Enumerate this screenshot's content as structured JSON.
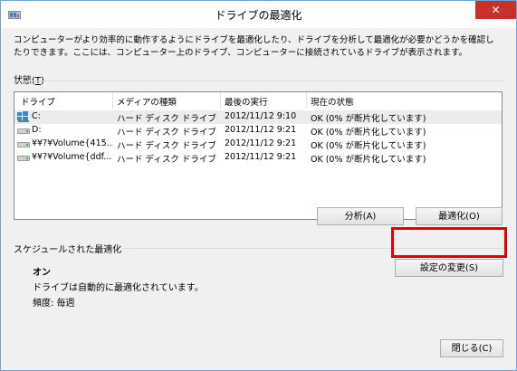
{
  "window": {
    "title": "ドライブの最適化",
    "close_label": "✕"
  },
  "description": "コンピューターがより効率的に動作するようにドライブを最適化したり、ドライブを分析して最適化が必要かどうかを確認したりできます。ここには、コンピューター上のドライブ、コンピューターに接続されているドライブが表示されます。",
  "status": {
    "label": "状態(",
    "accel": "T",
    "label_end": ")"
  },
  "table": {
    "columns": [
      "ドライブ",
      "メディアの種類",
      "最後の実行",
      "現在の状態"
    ],
    "rows": [
      {
        "drive": "C:",
        "media": "ハード ディスク ドライブ",
        "last_run": "2012/11/12 9:10",
        "status": "OK (0% が断片化しています)",
        "icon": "windows-drive-icon"
      },
      {
        "drive": "D:",
        "media": "ハード ディスク ドライブ",
        "last_run": "2012/11/12 9:21",
        "status": "OK (0% が断片化しています)",
        "icon": "hard-drive-icon"
      },
      {
        "drive": "¥¥?¥Volume{415...",
        "media": "ハード ディスク ドライブ",
        "last_run": "2012/11/12 9:21",
        "status": "OK (0% が断片化しています)",
        "icon": "hard-drive-icon"
      },
      {
        "drive": "¥¥?¥Volume{ddf...",
        "media": "ハード ディスク ドライブ",
        "last_run": "2012/11/12 9:21",
        "status": "OK (0% が断片化しています)",
        "icon": "hard-drive-icon"
      }
    ]
  },
  "buttons": {
    "analyze": "分析(A)",
    "optimize": "最適化(O)",
    "change_settings": "設定の変更(S)",
    "close": "閉じる(C)"
  },
  "schedule": {
    "heading": "スケジュールされた最適化",
    "state": "オン",
    "detail": "ドライブは自動的に最適化されています。",
    "frequency": "頻度: 毎週"
  },
  "colors": {
    "highlight": "#e00000",
    "close_button": "#c7312a"
  }
}
